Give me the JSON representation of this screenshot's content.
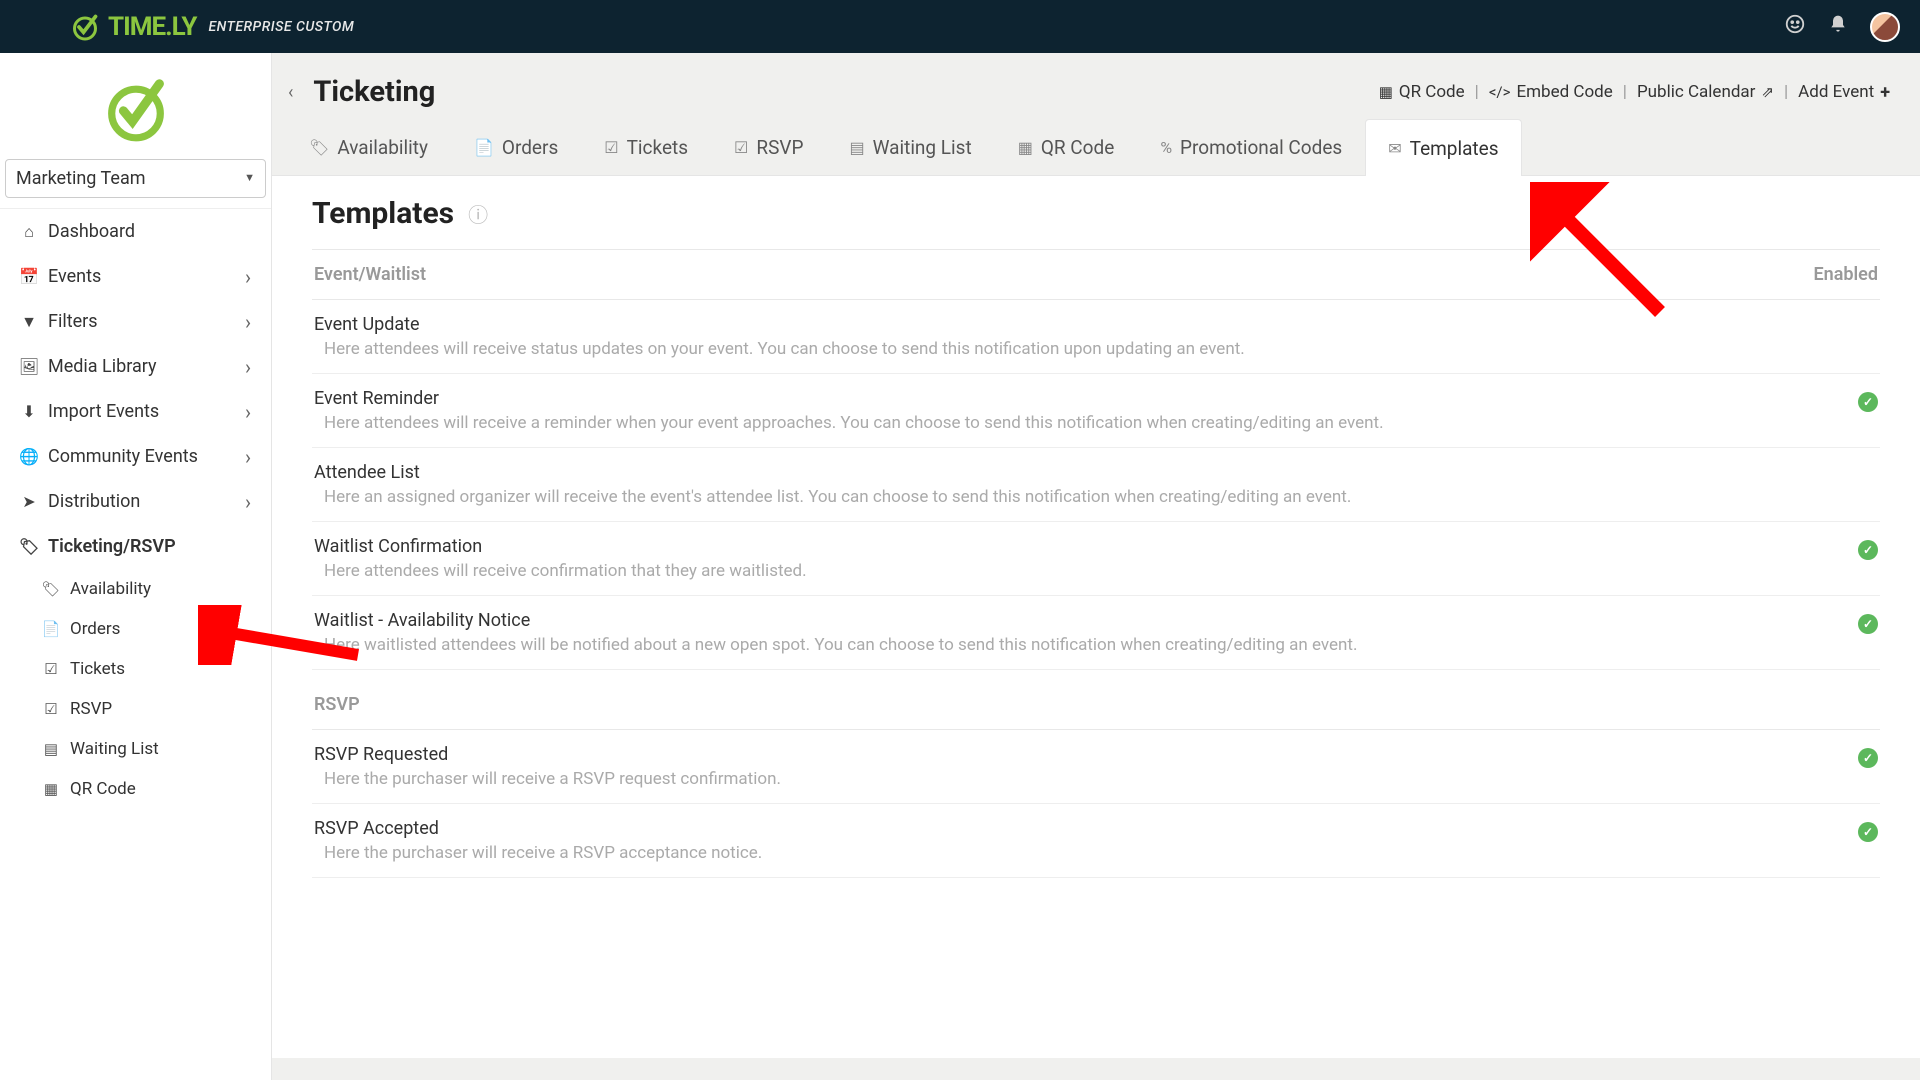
{
  "brand": {
    "name": "TIME.LY",
    "suffix": "ENTERPRISE CUSTOM"
  },
  "team_select": {
    "value": "Marketing Team"
  },
  "sidebar": {
    "items": [
      {
        "icon": "⌂",
        "label": "Dashboard",
        "children": false
      },
      {
        "icon": "📅",
        "label": "Events",
        "children": true
      },
      {
        "icon": "▼",
        "label": "Filters",
        "children": true
      },
      {
        "icon": "🖼",
        "label": "Media Library",
        "children": true
      },
      {
        "icon": "⬇",
        "label": "Import Events",
        "children": true
      },
      {
        "icon": "🌐",
        "label": "Community Events",
        "children": true
      },
      {
        "icon": "➤",
        "label": "Distribution",
        "children": true
      },
      {
        "icon": "🏷",
        "label": "Ticketing/RSVP",
        "children": false,
        "active": true
      }
    ],
    "subitems": [
      {
        "icon": "🏷",
        "label": "Availability"
      },
      {
        "icon": "📄",
        "label": "Orders"
      },
      {
        "icon": "☑",
        "label": "Tickets"
      },
      {
        "icon": "☑",
        "label": "RSVP"
      },
      {
        "icon": "▤",
        "label": "Waiting List"
      },
      {
        "icon": "▦",
        "label": "QR Code"
      }
    ]
  },
  "page": {
    "title": "Ticketing",
    "header_links": {
      "qr": "QR Code",
      "embed": "Embed Code",
      "public": "Public Calendar",
      "add": "Add Event"
    }
  },
  "tabs": [
    {
      "icon": "🏷",
      "label": "Availability"
    },
    {
      "icon": "📄",
      "label": "Orders"
    },
    {
      "icon": "☑",
      "label": "Tickets"
    },
    {
      "icon": "☑",
      "label": "RSVP"
    },
    {
      "icon": "▤",
      "label": "Waiting List"
    },
    {
      "icon": "▦",
      "label": "QR Code"
    },
    {
      "icon": "%",
      "label": "Promotional Codes"
    },
    {
      "icon": "✉",
      "label": "Templates",
      "active": true
    }
  ],
  "panel": {
    "title": "Templates",
    "section1": {
      "title": "Event/Waitlist",
      "col2": "Enabled"
    },
    "rows1": [
      {
        "name": "Event Update",
        "desc": "Here attendees will receive status updates on your event. You can choose to send this notification upon updating an event.",
        "enabled": false
      },
      {
        "name": "Event Reminder",
        "desc": "Here attendees will receive a reminder when your event approaches. You can choose to send this notification when creating/editing an event.",
        "enabled": true
      },
      {
        "name": "Attendee List",
        "desc": "Here an assigned organizer will receive the event's attendee list. You can choose to send this notification when creating/editing an event.",
        "enabled": false
      },
      {
        "name": "Waitlist Confirmation",
        "desc": "Here attendees will receive confirmation that they are waitlisted.",
        "enabled": true
      },
      {
        "name": "Waitlist - Availability Notice",
        "desc": "Here waitlisted attendees will be notified about a new open spot. You can choose to send this notification when creating/editing an event.",
        "enabled": true
      }
    ],
    "section2": {
      "title": "RSVP"
    },
    "rows2": [
      {
        "name": "RSVP Requested",
        "desc": "Here the purchaser will receive a RSVP request confirmation.",
        "enabled": true
      },
      {
        "name": "RSVP Accepted",
        "desc": "Here the purchaser will receive a RSVP acceptance notice.",
        "enabled": true
      }
    ]
  }
}
